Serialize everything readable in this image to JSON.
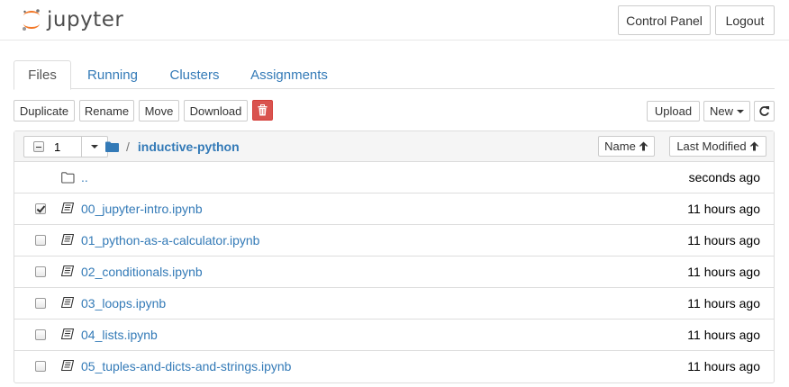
{
  "header": {
    "logo_text": "jupyter",
    "control_panel_label": "Control Panel",
    "logout_label": "Logout"
  },
  "tabs": [
    {
      "label": "Files",
      "active": true
    },
    {
      "label": "Running",
      "active": false
    },
    {
      "label": "Clusters",
      "active": false
    },
    {
      "label": "Assignments",
      "active": false
    }
  ],
  "toolbar": {
    "duplicate_label": "Duplicate",
    "rename_label": "Rename",
    "move_label": "Move",
    "download_label": "Download",
    "delete_icon": "trash-icon",
    "upload_label": "Upload",
    "new_label": "New",
    "refresh_icon": "refresh-icon"
  },
  "list_header": {
    "selected_count": "1",
    "separator": "/",
    "current_dir": "inductive-python",
    "sort_name_label": "Name",
    "sort_modified_label": "Last Modified"
  },
  "files": [
    {
      "name": "..",
      "type": "folder",
      "modified": "seconds ago",
      "checkbox": false,
      "checked": false
    },
    {
      "name": "00_jupyter-intro.ipynb",
      "type": "notebook",
      "modified": "11 hours ago",
      "checkbox": true,
      "checked": true
    },
    {
      "name": "01_python-as-a-calculator.ipynb",
      "type": "notebook",
      "modified": "11 hours ago",
      "checkbox": true,
      "checked": false
    },
    {
      "name": "02_conditionals.ipynb",
      "type": "notebook",
      "modified": "11 hours ago",
      "checkbox": true,
      "checked": false
    },
    {
      "name": "03_loops.ipynb",
      "type": "notebook",
      "modified": "11 hours ago",
      "checkbox": true,
      "checked": false
    },
    {
      "name": "04_lists.ipynb",
      "type": "notebook",
      "modified": "11 hours ago",
      "checkbox": true,
      "checked": false
    },
    {
      "name": "05_tuples-and-dicts-and-strings.ipynb",
      "type": "notebook",
      "modified": "11 hours ago",
      "checkbox": true,
      "checked": false
    }
  ],
  "colors": {
    "link": "#337ab7",
    "jupyter_orange": "#f37726",
    "danger": "#d9534f"
  }
}
